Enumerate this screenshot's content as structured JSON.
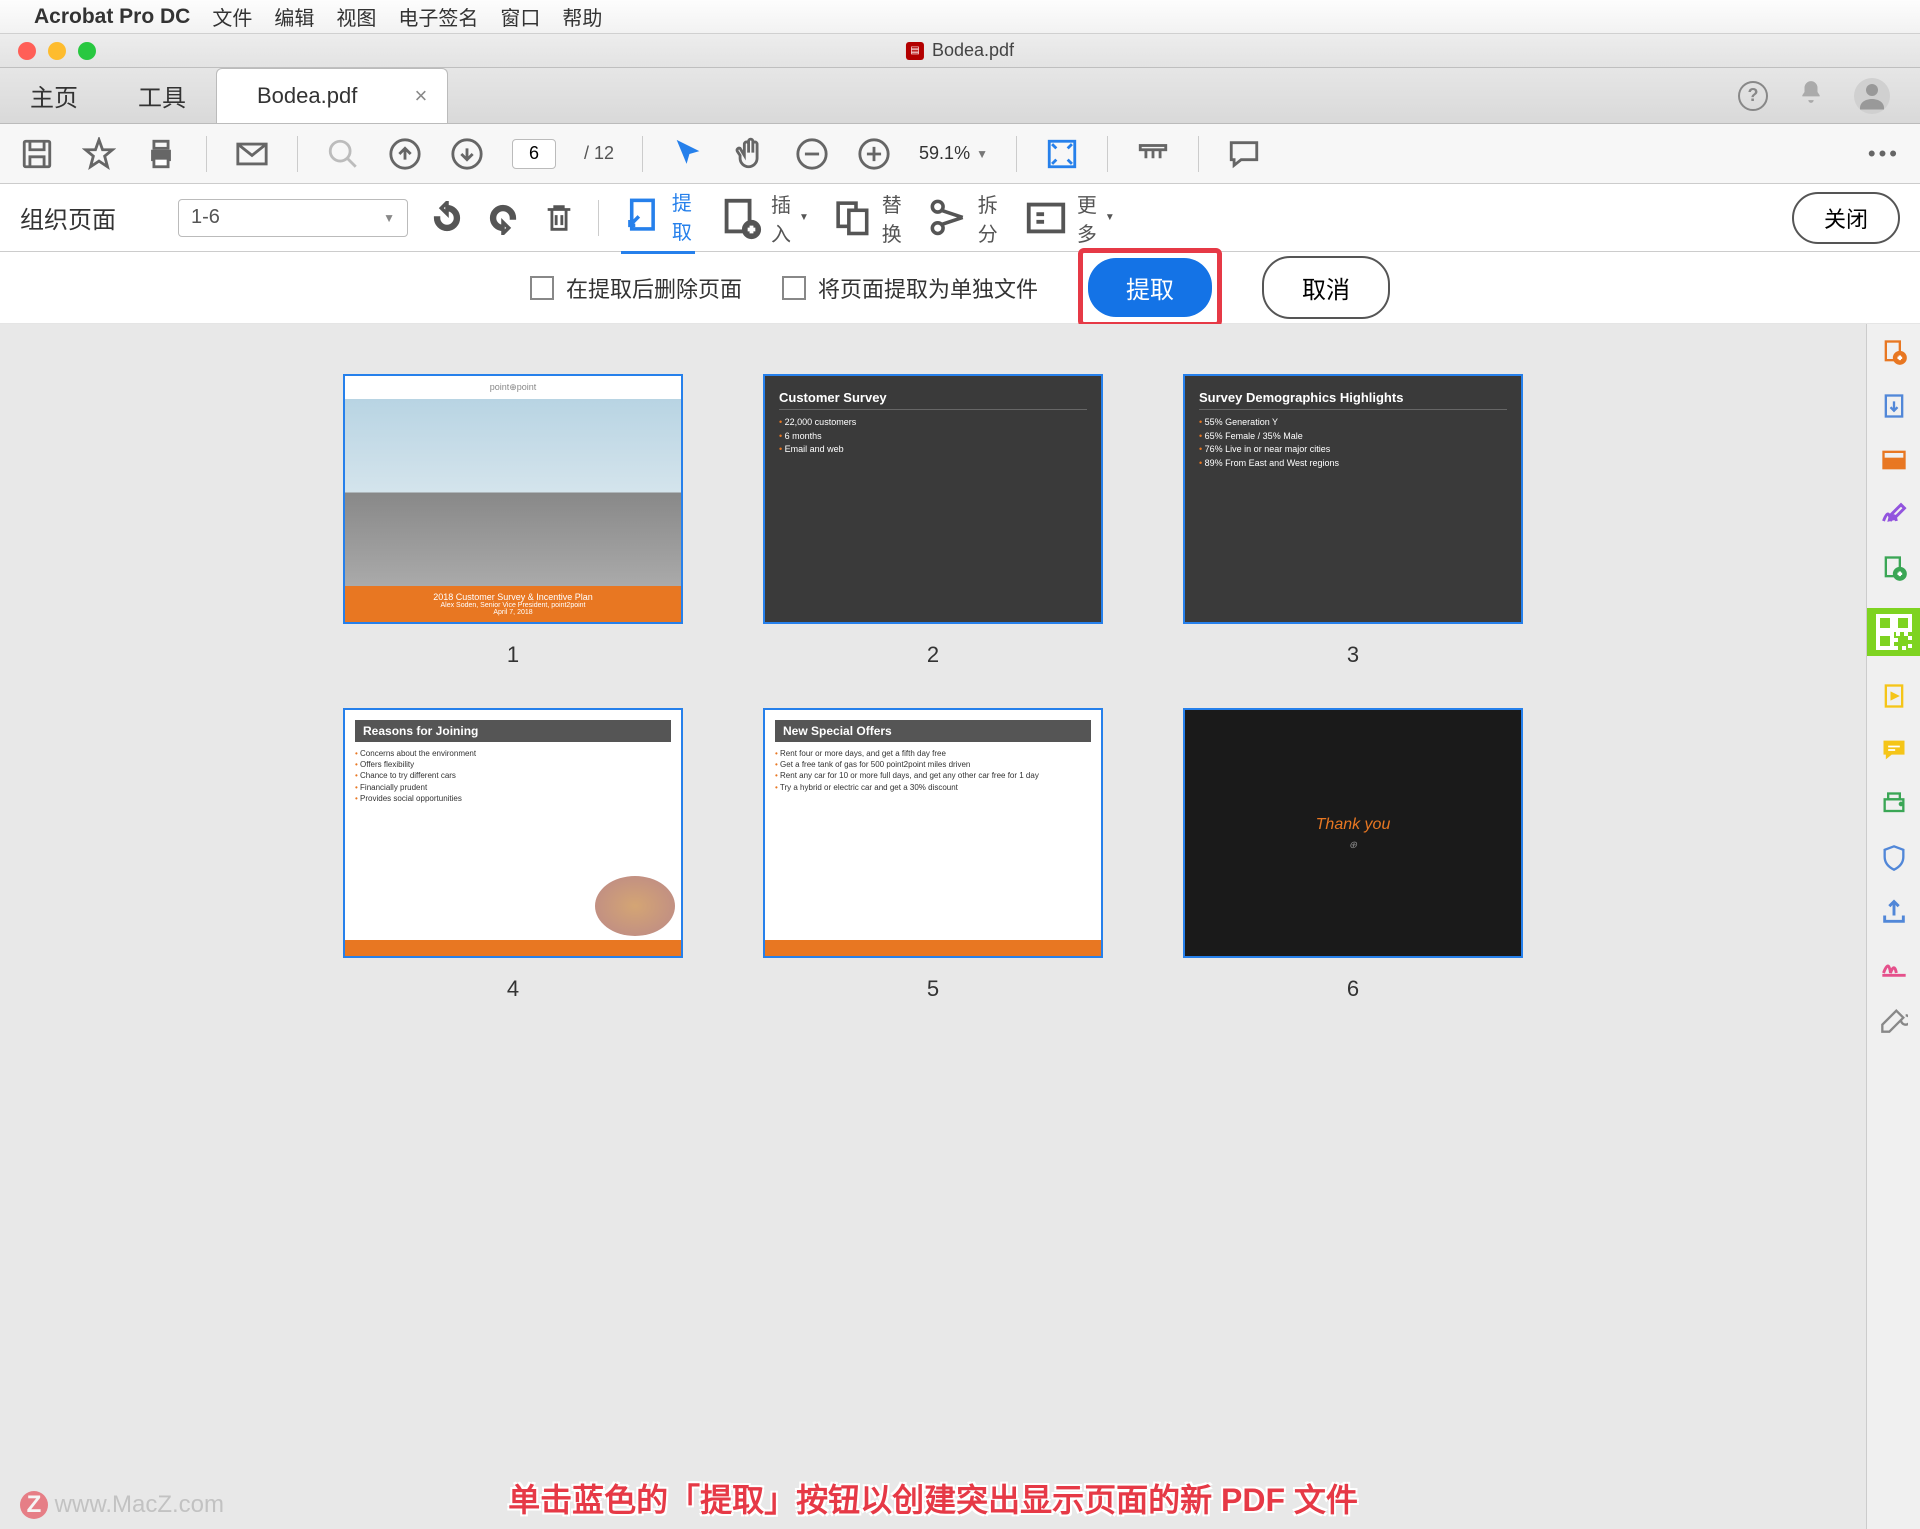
{
  "menubar": {
    "apple": "",
    "app": "Acrobat Pro DC",
    "items": [
      "文件",
      "编辑",
      "视图",
      "电子签名",
      "窗口",
      "帮助"
    ]
  },
  "titlebar": {
    "file": "Bodea.pdf"
  },
  "tabs": {
    "home": "主页",
    "tools": "工具",
    "active": "Bodea.pdf",
    "close": "×"
  },
  "toolbar1": {
    "page_current": "6",
    "page_total": "/ 12",
    "zoom": "59.1%"
  },
  "organize": {
    "title": "组织页面",
    "page_range": "1-6",
    "extract": "提取",
    "insert": "插入",
    "replace": "替换",
    "split": "拆分",
    "more": "更多",
    "close": "关闭"
  },
  "extract_options": {
    "delete_after": "在提取后删除页面",
    "separate_files": "将页面提取为单独文件",
    "extract_btn": "提取",
    "cancel_btn": "取消"
  },
  "thumbnails": [
    {
      "num": "1",
      "type": "title",
      "logo": "point⊕point",
      "title": "2018 Customer Survey & Incentive Plan",
      "sub": "Alex Soden, Senior Vice President, point2point",
      "date": "April 7, 2018"
    },
    {
      "num": "2",
      "type": "dark",
      "title": "Customer Survey",
      "bullets": [
        "22,000 customers",
        "6 months",
        "Email and web"
      ]
    },
    {
      "num": "3",
      "type": "dark",
      "title": "Survey Demographics Highlights",
      "bullets": [
        "55% Generation Y",
        "65% Female / 35% Male",
        "76% Live in or near major cities",
        "89% From East and West regions"
      ]
    },
    {
      "num": "4",
      "type": "reasons",
      "title": "Reasons for Joining",
      "bullets": [
        "Concerns about the environment",
        "Offers flexibility",
        "Chance to try different cars",
        "Financially prudent",
        "Provides social opportunities"
      ]
    },
    {
      "num": "5",
      "type": "offers",
      "title": "New Special Offers",
      "bullets": [
        "Rent four or more days, and get a fifth day free",
        "Get a free tank of gas for 500 point2point miles driven",
        "Rent any car for 10 or more full days, and get any other car free for 1 day",
        "Try a hybrid or electric car and get a 30% discount"
      ]
    },
    {
      "num": "6",
      "type": "thanks",
      "text": "Thank you"
    }
  ],
  "annotation": "单击蓝色的「提取」按钮以创建突出显示页面的新 PDF 文件",
  "watermark": "www.MacZ.com",
  "sidebar_icons": [
    "create-pdf",
    "export-pdf",
    "edit-pdf",
    "sign-pdf",
    "combine-pdf",
    "organize-pdf",
    "compress-pdf",
    "comment-pdf",
    "print-pdf",
    "protect-pdf",
    "share-pdf",
    "redact-pdf",
    "more-tools"
  ]
}
